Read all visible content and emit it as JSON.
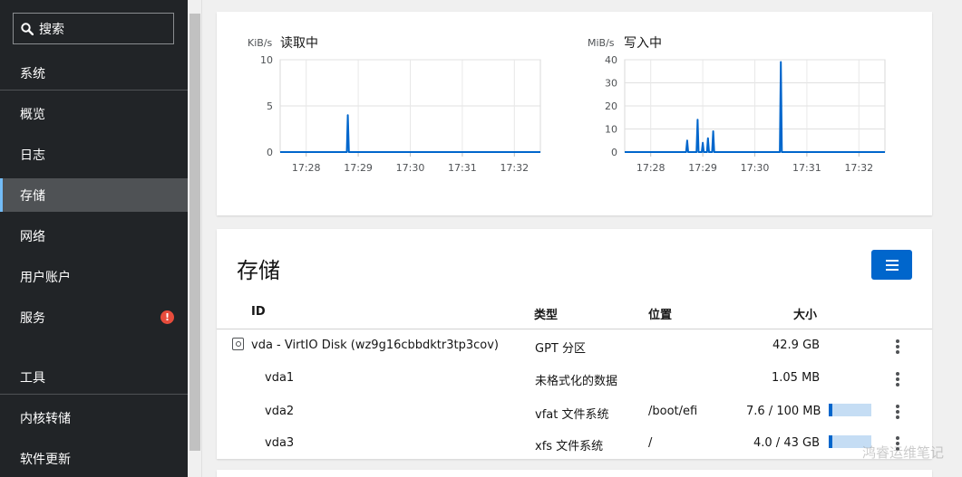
{
  "sidebar": {
    "search_label": "搜索",
    "items": [
      {
        "label": "系统"
      },
      {
        "label": "概览"
      },
      {
        "label": "日志"
      },
      {
        "label": "存储"
      },
      {
        "label": "网络"
      },
      {
        "label": "用户账户"
      },
      {
        "label": "服务",
        "alert": "!"
      },
      {
        "label": "工具"
      },
      {
        "label": "内核转储"
      },
      {
        "label": "软件更新"
      }
    ]
  },
  "charts": {
    "read": {
      "title": "读取中",
      "unit": "KiB/s",
      "yticks": [
        "10",
        "5",
        "0"
      ],
      "xticks": [
        "17:28",
        "17:29",
        "17:30",
        "17:31",
        "17:32"
      ]
    },
    "write": {
      "title": "写入中",
      "unit": "MiB/s",
      "yticks": [
        "40",
        "30",
        "20",
        "10",
        "0"
      ],
      "xticks": [
        "17:28",
        "17:29",
        "17:30",
        "17:31",
        "17:32"
      ]
    }
  },
  "chart_data": [
    {
      "type": "area",
      "title": "读取中",
      "ylabel": "KiB/s",
      "ylim": [
        0,
        10
      ],
      "x": [
        "17:27.5",
        "17:28.77",
        "17:28.8",
        "17:28.83",
        "17:32.5"
      ],
      "series": [
        {
          "values": [
            0,
            0,
            4,
            0,
            0
          ]
        }
      ]
    },
    {
      "type": "area",
      "title": "写入中",
      "ylabel": "MiB/s",
      "ylim": [
        0,
        40
      ],
      "x": [
        "17:27.5",
        "17:28.7",
        "17:28.9",
        "17:29.0",
        "17:29.1",
        "17:29.2",
        "17:30.5",
        "17:32.5"
      ],
      "series": [
        {
          "values": [
            0,
            5,
            14,
            4,
            6,
            9,
            39,
            0
          ]
        }
      ]
    }
  ],
  "storage": {
    "title": "存储",
    "columns": {
      "id": "ID",
      "type": "类型",
      "location": "位置",
      "size": "大小"
    },
    "rows": [
      {
        "id": "vda - VirtIO Disk (wz9g16cbbdktr3tp3cov)",
        "type": "GPT 分区",
        "location": "",
        "size": "42.9 GB"
      },
      {
        "id": "vda1",
        "type": "未格式化的数据",
        "location": "",
        "size": "1.05 MB"
      },
      {
        "id": "vda2",
        "type": "vfat 文件系统",
        "location": "/boot/efi",
        "size": "7.6 / 100 MB",
        "usage": 0.076
      },
      {
        "id": "vda3",
        "type": "xfs 文件系统",
        "location": "/",
        "size": "4.0 / 43 GB",
        "usage": 0.093
      }
    ]
  },
  "watermark": "鸿睿运维笔记",
  "colors": {
    "accent": "#0066cc",
    "sidebar_bg": "#212427",
    "alert": "#e74c3c"
  }
}
